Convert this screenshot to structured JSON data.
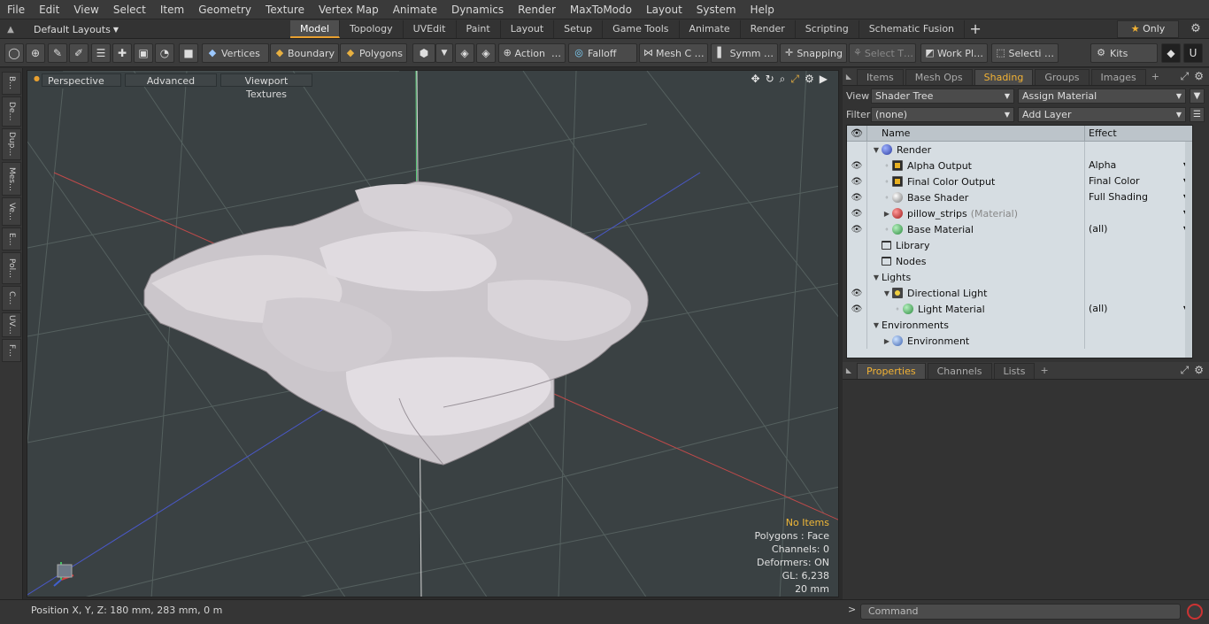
{
  "menu": [
    "File",
    "Edit",
    "View",
    "Select",
    "Item",
    "Geometry",
    "Texture",
    "Vertex Map",
    "Animate",
    "Dynamics",
    "Render",
    "MaxToModo",
    "Layout",
    "System",
    "Help"
  ],
  "layout": {
    "label": "Default Layouts",
    "tabs": [
      "Model",
      "Topology",
      "UVEdit",
      "Paint",
      "Layout",
      "Setup",
      "Game Tools",
      "Animate",
      "Render",
      "Scripting",
      "Schematic Fusion"
    ],
    "active_tab": "Model",
    "only_label": "Only"
  },
  "toolbar": {
    "vertices": "Vertices",
    "boundary": "Boundary",
    "polygons": "Polygons",
    "action": "Action",
    "action_more": "…",
    "falloff": "Falloff",
    "mesh": "Mesh C …",
    "symm": "Symm …",
    "snapping": "Snapping",
    "select_t": "Select T…",
    "work": "Work Pl…",
    "selecti": "Selecti …",
    "kits": "Kits"
  },
  "left_tabs": [
    "B…",
    "De…",
    "Dup…",
    "Mes…",
    "Ve…",
    "E…",
    "Pol…",
    "C…",
    "UV…",
    "F…"
  ],
  "viewport": {
    "view": "Perspective",
    "advanced": "Advanced",
    "textures": "Viewport Textures",
    "stats": {
      "items": "No Items",
      "polygons": "Polygons : Face",
      "channels": "Channels: 0",
      "deformers": "Deformers: ON",
      "gl": "GL: 6,238",
      "unit": "20 mm"
    }
  },
  "status": {
    "position": "Position X, Y, Z:   180 mm, 283 mm, 0 m"
  },
  "panel": {
    "tabs": [
      "Items",
      "Mesh Ops",
      "Shading",
      "Groups",
      "Images"
    ],
    "active_tab": "Shading",
    "view_label": "View",
    "view_value": "Shader Tree",
    "assign": "Assign Material",
    "filter_label": "Filter",
    "filter_value": "(none)",
    "add_layer": "Add Layer",
    "col_name": "Name",
    "col_effect": "Effect",
    "rows": [
      {
        "name": "Render",
        "effect": "",
        "icon": "blue",
        "eye": false,
        "indent": 0,
        "tw": "▼"
      },
      {
        "name": "Alpha Output",
        "effect": "Alpha",
        "icon": "img",
        "eye": true,
        "indent": 1,
        "tw": "◦"
      },
      {
        "name": "Final Color Output",
        "effect": "Final Color",
        "icon": "img",
        "eye": true,
        "indent": 1,
        "tw": "◦"
      },
      {
        "name": "Base Shader",
        "effect": "Full Shading",
        "icon": "gray",
        "eye": true,
        "indent": 1,
        "tw": "◦"
      },
      {
        "name": "pillow_strips",
        "muted": "(Material)",
        "effect": "",
        "icon": "red",
        "eye": true,
        "indent": 1,
        "tw": "▶"
      },
      {
        "name": "Base Material",
        "effect": "(all)",
        "icon": "green",
        "eye": true,
        "indent": 1,
        "tw": "◦"
      },
      {
        "name": "Library",
        "effect": "",
        "icon": "folder",
        "eye": false,
        "indent": 0,
        "tw": ""
      },
      {
        "name": "Nodes",
        "effect": "",
        "icon": "folder",
        "eye": false,
        "indent": 0,
        "tw": ""
      },
      {
        "name": "Lights",
        "effect": "",
        "icon": "",
        "eye": false,
        "indent": 0,
        "tw": "▼"
      },
      {
        "name": "Directional Light",
        "effect": "",
        "icon": "light",
        "eye": true,
        "indent": 1,
        "tw": "▼"
      },
      {
        "name": "Light Material",
        "effect": "(all)",
        "icon": "green",
        "eye": true,
        "indent": 2,
        "tw": "◦"
      },
      {
        "name": "Environments",
        "effect": "",
        "icon": "",
        "eye": false,
        "indent": 0,
        "tw": "▼"
      },
      {
        "name": "Environment",
        "effect": "",
        "icon": "env",
        "eye": false,
        "indent": 1,
        "tw": "▶"
      }
    ],
    "bottom_tabs": [
      "Properties",
      "Channels",
      "Lists"
    ],
    "bottom_active": "Properties"
  },
  "command": {
    "placeholder": "Command"
  }
}
